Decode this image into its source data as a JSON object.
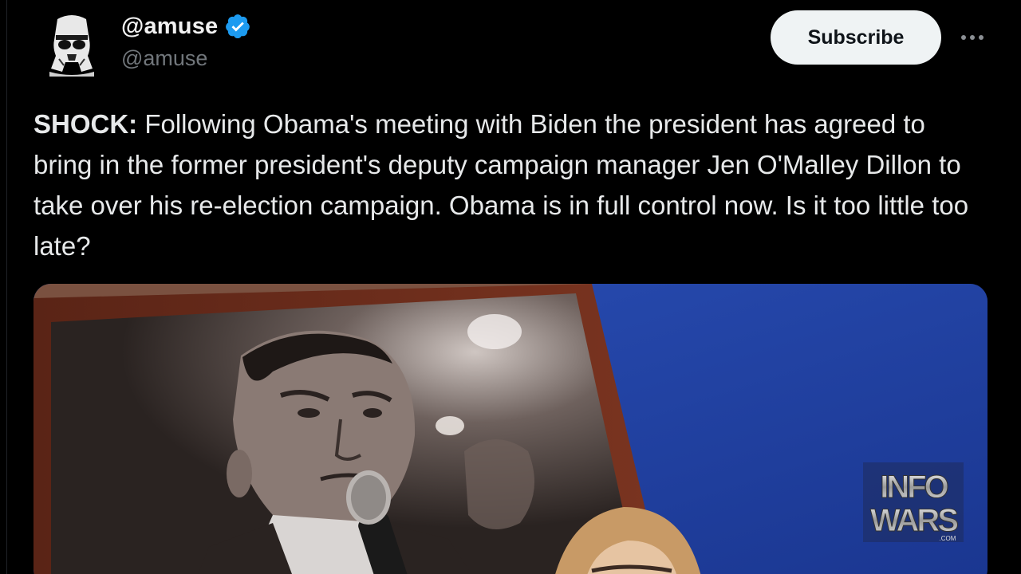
{
  "account": {
    "display_name": "@amuse",
    "handle": "@amuse",
    "verified": true,
    "avatar_icon": "stormtrooper-helmet-icon"
  },
  "actions": {
    "subscribe_label": "Subscribe",
    "more_icon": "more-horizontal-icon"
  },
  "post": {
    "lead": "SHOCK:",
    "body": " Following Obama's meeting with Biden the president has agreed to bring in the former president's deputy campaign manager Jen O'Malley Dillon to take over his re-election campaign. Obama is in full control now. Is it too little too late?"
  },
  "media": {
    "watermark_top": "INFO",
    "watermark_bottom": "WARS",
    "watermark_suffix": ".COM"
  },
  "colors": {
    "background": "#000000",
    "text": "#e7e9ea",
    "secondary_text": "#71767b",
    "verified_blue": "#1d9bf0",
    "button_bg": "#eff3f4"
  }
}
